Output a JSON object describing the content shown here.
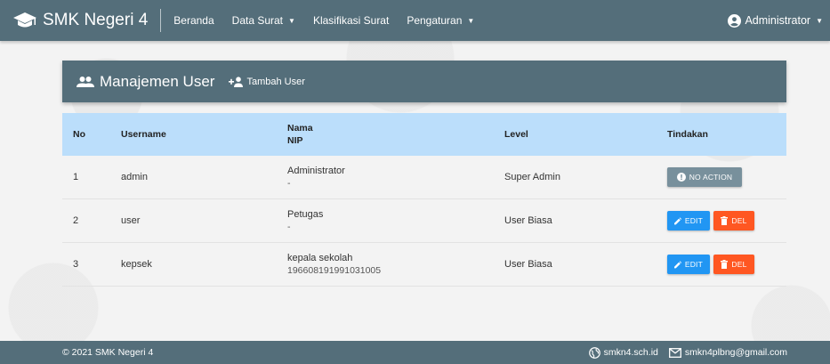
{
  "navbar": {
    "brand": "SMK Negeri 4",
    "items": [
      {
        "label": "Beranda",
        "dropdown": false
      },
      {
        "label": "Data Surat",
        "dropdown": true
      },
      {
        "label": "Klasifikasi Surat",
        "dropdown": false
      },
      {
        "label": "Pengaturan",
        "dropdown": true
      }
    ],
    "user": "Administrator",
    "caret": "▼"
  },
  "card": {
    "title": "Manajemen User",
    "add_label": "Tambah User"
  },
  "table": {
    "headers": {
      "no": "No",
      "username": "Username",
      "nama": "Nama",
      "nip": "NIP",
      "level": "Level",
      "tindakan": "Tindakan"
    },
    "rows": [
      {
        "no": "1",
        "username": "admin",
        "nama": "Administrator",
        "nip": "-",
        "level": "Super Admin"
      },
      {
        "no": "2",
        "username": "user",
        "nama": "Petugas",
        "nip": "-",
        "level": "User Biasa"
      },
      {
        "no": "3",
        "username": "kepsek",
        "nama": "kepala sekolah",
        "nip": "196608191991031005",
        "level": "User Biasa"
      }
    ],
    "actions": {
      "no_action": "NO ACTION",
      "edit": "EDIT",
      "del": "DEL"
    }
  },
  "footer": {
    "copyright": "© 2021 SMK Negeri 4",
    "website": "smkn4.sch.id",
    "email": "smkn4plbng@gmail.com"
  },
  "colors": {
    "primary": "#546e7a",
    "table_header": "#bbdefb",
    "edit": "#2196f3",
    "del": "#ff5722",
    "no_action": "#78909c"
  }
}
